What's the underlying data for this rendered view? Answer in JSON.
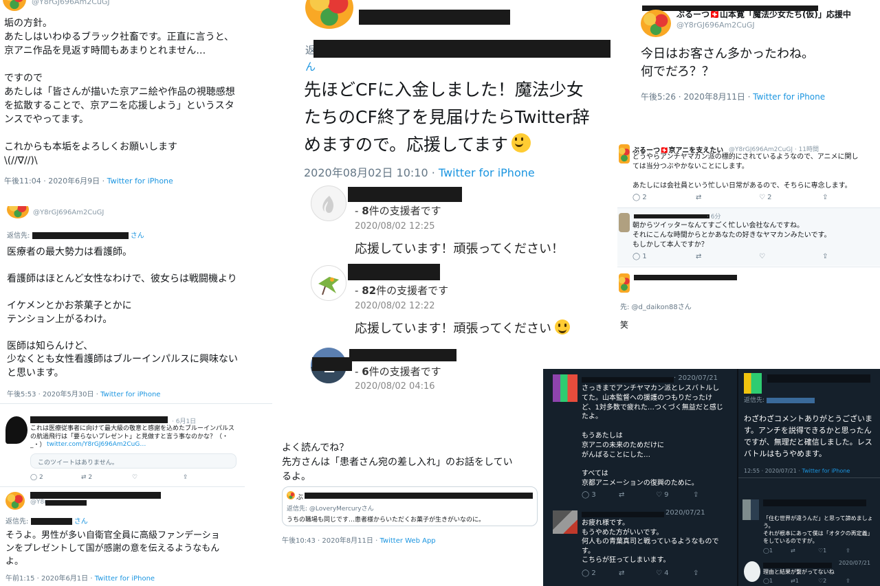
{
  "p1": {
    "handle": "@Y8rGJ696Am2CuGJ",
    "text": "垢の方針。\nあたしはいわゆるブラック社畜です。正直に言うと、\n京アニ作品を見返す時間もあまりとれません…\n\nですので\nあたしは「皆さんが描いた京アニ絵や作品の視聴感想\nを拡散することで、京アニを応援しよう」というスタ\nンスでやってます。\n\nこれからも本垢をよろしくお願いします\n\\(//∇//)\\",
    "time": "午後11:04 · 2020年6月9日 · ",
    "source": "Twitter for iPhone"
  },
  "p2": {
    "text_line1": "先ほどCFに入金しました！魔法少女",
    "text_line2": "たちのCF終了を見届けたらTwitter辞",
    "text_line3": "めますので。応援してます",
    "trail": "ん",
    "lead": "返",
    "time": "2020年08月02日 10:10 · ",
    "source": "Twitter for iPhone",
    "supporters": [
      {
        "count": "8",
        "label": "件の支援者です",
        "date": "2020/08/02 12:25",
        "message": "応援しています！頑張ってください！"
      },
      {
        "count": "82",
        "label": "件の支援者です",
        "date": "2020/08/02 12:22",
        "message": "応援しています！頑張ってください"
      },
      {
        "count": "6",
        "label": "件の支援者です",
        "date": "2020/08/02 04:16",
        "message": ""
      }
    ]
  },
  "p3": {
    "name": "ぶるーつ🇨🇭山本寛「魔法少女たち(仮)」応援中",
    "handle": "@Y8rGJ696Am2CuGJ",
    "text": "今日はお客さん多かったわね。\n何でだろ？？",
    "time": "午後5:26 · 2020年8月11日 · ",
    "source": "Twitter for iPhone"
  },
  "p4": {
    "t1_name": "ぶるーつ🇨🇭京アニを支えたい",
    "t1_handle": "@Y8rGJ696Am2CuGJ · 11時間",
    "t1_text": "どうやらアンチヤマカン派の標的にされているようなので、アニメに関し\nては当分つぶやかないことにします。\n\nあたしには会社員という忙しい日常があるので、そちらに専念します。",
    "t1_actions": [
      "2",
      "",
      "2",
      ""
    ],
    "t2_time": "· 6分",
    "t2_text": "朝からツイッターなんてすごく忙しい会社なんですね。\nそれにこんな時間からとかあなたの好きなヤマカンみたいです。\nもしかして本人ですか？",
    "t2_actions": [
      "1",
      "",
      "",
      ""
    ],
    "t3_reply": "先: @d_daikon88さん",
    "t3_text": "笑"
  },
  "p5": {
    "handle": "@Y8rGJ696Am2CuGJ",
    "reply_to": "返信先:",
    "reply_suffix": "さん",
    "text": "医療者の最大勢力は看護師。\n\n看護師はほとんど女性なわけで、彼女らは戦闘機より\n\nイケメンとかお茶菓子とかに\nテンション上がるわけ。\n\n医師は知らんけど、\n少なくとも女性看護師はブルーインパルスに興味ない\nと思います。",
    "time": "午後5:53 · 2020年5月30日 · ",
    "source": "Twitter for iPhone"
  },
  "p6": {
    "t1_date": "· 6月1日",
    "t1_text": "これは医療従事者に向けて最大級の敬意と感謝を込めたブルーインパルス\nの航過飛行は「要らないプレゼント」と見做すと言う事なのかな？（・\n_・）",
    "t1_link": "twitter.com/Y8rGJ696Am2CuG…",
    "t1_quote": "このツイートはありません。",
    "t1_actions": [
      "2",
      "2",
      "",
      ""
    ],
    "t2_handle": "@Y8r",
    "reply_to": "返信先:",
    "reply_suffix": "さん",
    "t2_text": "そうよ。男性が多い自衛官全員に高級ファンデーショ\nンをプレゼントして国が感謝の意を伝えるようなもん\nよ。",
    "time": "午前1:15 · 2020年6月1日 · ",
    "source": "Twitter for iPhone"
  },
  "p7": {
    "text": "よく読んでね？\n先方さんは「患者さん宛の差し入れ」のお話をしてい\nるよ。",
    "quote_lead": "ぶ",
    "quote_reply": "返信先: @LoveryMercuryさん",
    "quote_text": "うちの職場も同じです…患者様からいただくお菓子が生きがいなのに。",
    "time": "午後10:43 · 2020年8月11日 · ",
    "source": "Twitter Web App"
  },
  "p8": {
    "t1_date": "· 2020/07/21",
    "t1_text": "さっきまでアンチヤマカン派とレスバトルし\nてた。山本監督への援護のつもりだったけ\nど、1対多数で疲れた…つくづく無益だと感じ\nたよ。\n\nもうあたしは\n京アニの未来のためだけに\nがんばることにした…\n\nすべては\n京都アニメーションの復興のために。",
    "t1_actions": [
      "3",
      "",
      "9",
      ""
    ],
    "t2_date": "2020/07/21",
    "t2_text": "お疲れ様です。\nもうやめた方がいいです。\n何人もの青葉真司と戦っているようなもので\nす。\nこちらが狂ってしまいます。",
    "t2_actions": [
      "2",
      "",
      "4",
      ""
    ],
    "t3_reply": "返信先:",
    "t3_text": "わざわざコメントありがとうございま\nす。アンチを説得できるかと思ったん\nですが、無理だと確信しました。レス\nバトルはもうやめます。",
    "t3_time": "12:55 · 2020/07/21 · ",
    "t3_source": "Twitter for iPhone",
    "t4_text": "「住む世界が違うんだ」と思って諦めましょ\nう。\nそれが根本にあって僕は「オタクの再定義」\nをしているのですが。",
    "t4_actions": [
      "1",
      "",
      "1",
      ""
    ],
    "t5_date": "2020/07/21",
    "t5_text": "理由と結果が繋がってないね",
    "t5_actions": [
      "1",
      "1",
      "2",
      ""
    ]
  }
}
